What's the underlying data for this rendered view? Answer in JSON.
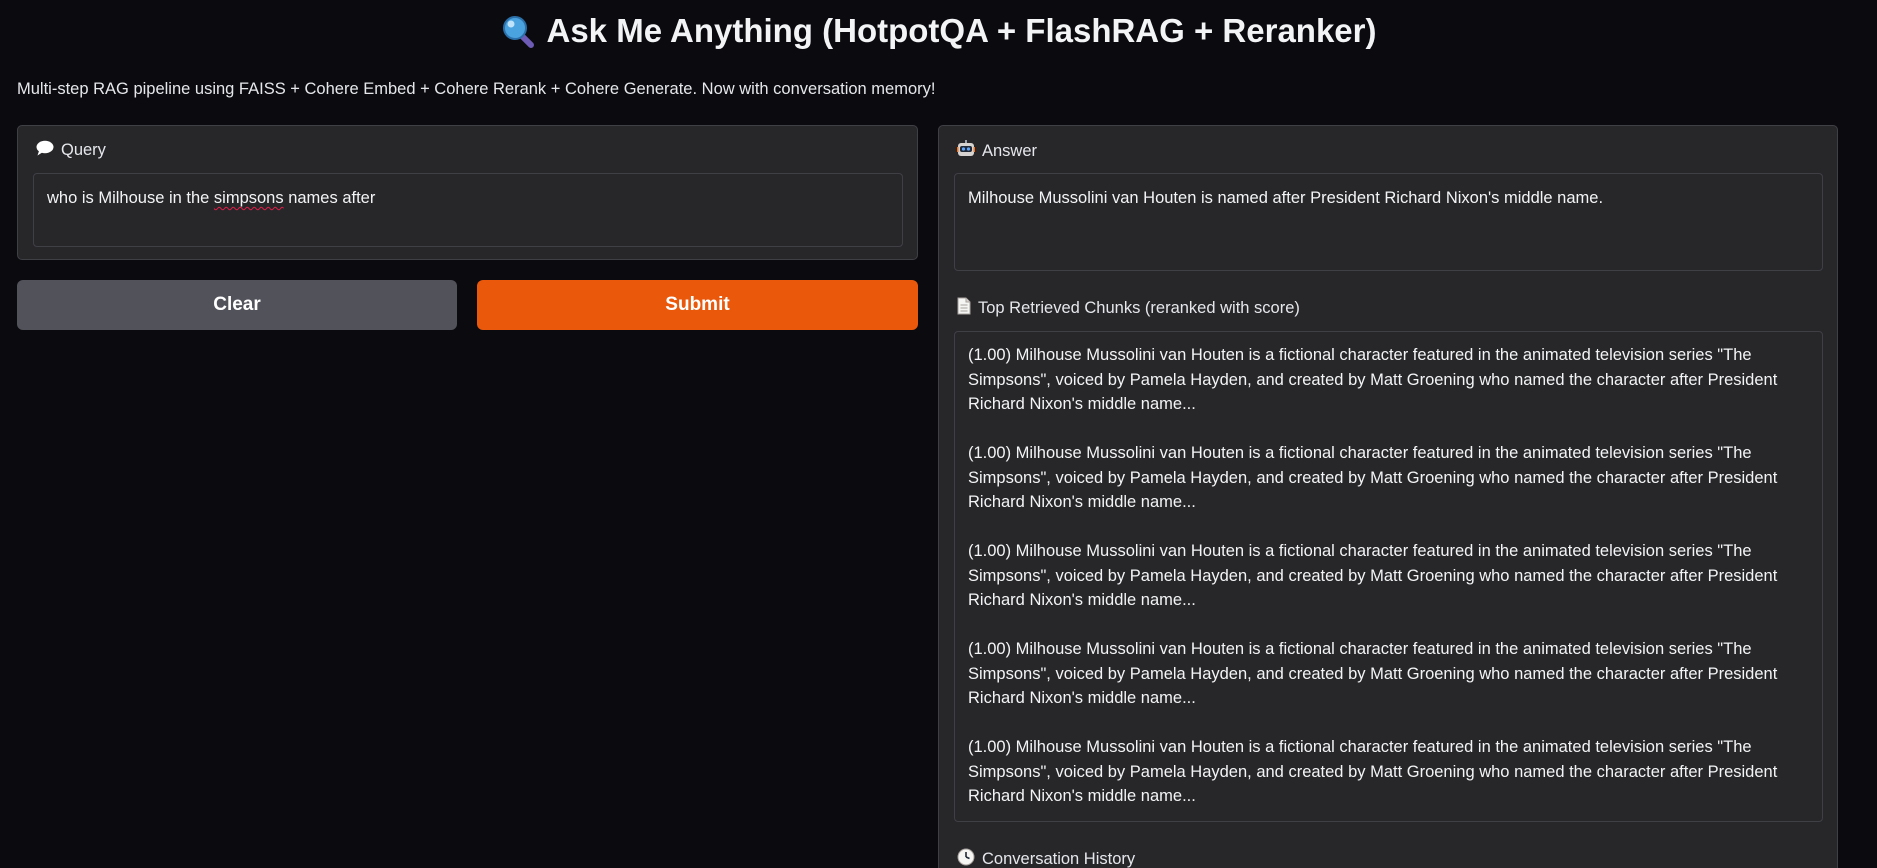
{
  "header": {
    "title": "Ask Me Anything (HotpotQA + FlashRAG + Reranker)",
    "title_icon": "magnifier-icon",
    "subtitle": "Multi-step RAG pipeline using FAISS + Cohere Embed + Cohere Rerank + Cohere Generate. Now with conversation memory!"
  },
  "query": {
    "label": "Query",
    "icon": "speech-bubble-icon",
    "value_before": "who is Milhouse in the ",
    "value_misspelled": "simpsons",
    "value_after": " names after"
  },
  "buttons": {
    "clear_label": "Clear",
    "submit_label": "Submit"
  },
  "answer": {
    "label": "Answer",
    "icon": "robot-icon",
    "text": "Milhouse Mussolini van Houten is named after President Richard Nixon's middle name."
  },
  "chunks": {
    "label": "Top Retrieved Chunks (reranked with score)",
    "icon": "page-icon",
    "items": [
      {
        "text": "(1.00) Milhouse Mussolini van Houten is a fictional character featured in the animated television series \"The Simpsons\", voiced by Pamela Hayden, and created by Matt Groening who named the character after President Richard Nixon's middle name..."
      },
      {
        "text": "(1.00) Milhouse Mussolini van Houten is a fictional character featured in the animated television series \"The Simpsons\", voiced by Pamela Hayden, and created by Matt Groening who named the character after President Richard Nixon's middle name..."
      },
      {
        "text": "(1.00) Milhouse Mussolini van Houten is a fictional character featured in the animated television series \"The Simpsons\", voiced by Pamela Hayden, and created by Matt Groening who named the character after President Richard Nixon's middle name..."
      },
      {
        "text": "(1.00) Milhouse Mussolini van Houten is a fictional character featured in the animated television series \"The Simpsons\", voiced by Pamela Hayden, and created by Matt Groening who named the character after President Richard Nixon's middle name..."
      },
      {
        "text": "(1.00) Milhouse Mussolini van Houten is a fictional character featured in the animated television series \"The Simpsons\", voiced by Pamela Hayden, and created by Matt Groening who named the character after President Richard Nixon's middle name..."
      }
    ]
  },
  "history": {
    "label": "Conversation History",
    "icon": "clock-icon"
  },
  "colors": {
    "background": "#0b0b0f",
    "panel": "#27272a",
    "border": "#3f3f46",
    "accent": "#ea580c",
    "secondary_button": "#52525b"
  }
}
